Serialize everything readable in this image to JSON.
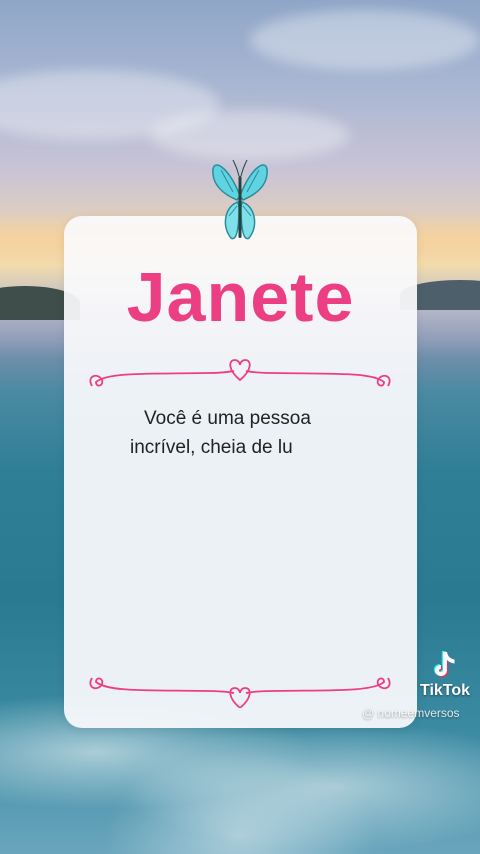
{
  "card": {
    "name": "Janete",
    "message_line1": "Você é uma pessoa",
    "message_line2": "incrível, cheia de lu"
  },
  "watermark": {
    "brand": "TikTok",
    "handle": "@ nomeemversos"
  },
  "icons": {
    "butterfly": "butterfly-icon",
    "tiktok_logo": "tiktok-logo-icon"
  },
  "colors": {
    "accent_pink": "#ec3f83",
    "butterfly_teal": "#5fd3e0"
  }
}
